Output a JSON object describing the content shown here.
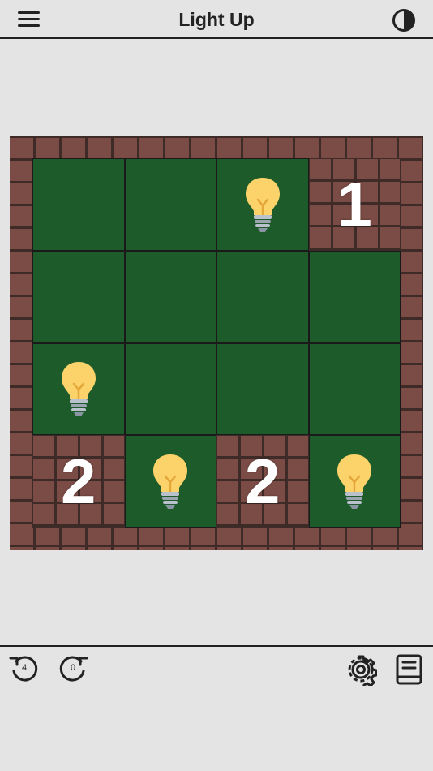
{
  "header": {
    "title": "Light Up"
  },
  "board": {
    "rows": 4,
    "cols": 4,
    "cells": [
      [
        {
          "type": "open",
          "bulb": false
        },
        {
          "type": "open",
          "bulb": false
        },
        {
          "type": "open",
          "bulb": true
        },
        {
          "type": "wall",
          "clue": "1"
        }
      ],
      [
        {
          "type": "open",
          "bulb": false
        },
        {
          "type": "open",
          "bulb": false
        },
        {
          "type": "open",
          "bulb": false
        },
        {
          "type": "open",
          "bulb": false
        }
      ],
      [
        {
          "type": "open",
          "bulb": true
        },
        {
          "type": "open",
          "bulb": false
        },
        {
          "type": "open",
          "bulb": false
        },
        {
          "type": "open",
          "bulb": false
        }
      ],
      [
        {
          "type": "wall",
          "clue": "2"
        },
        {
          "type": "open",
          "bulb": true
        },
        {
          "type": "wall",
          "clue": "2"
        },
        {
          "type": "open",
          "bulb": true
        }
      ]
    ]
  },
  "toolbar": {
    "undo_count": "4",
    "redo_count": "0"
  },
  "icons": {
    "menu": "hamburger-menu-icon",
    "contrast": "contrast-icon",
    "undo": "undo-icon",
    "redo": "redo-icon",
    "settings": "gear-icon",
    "rules": "book-icon",
    "bulb": "light-bulb-icon"
  },
  "colors": {
    "background": "#e4e4e4",
    "open_cell": "#1e5b2a",
    "brick": "#7b4b45",
    "mortar": "#3e2a27",
    "bulb": "#fcd36b",
    "clue_text": "#ffffff"
  }
}
